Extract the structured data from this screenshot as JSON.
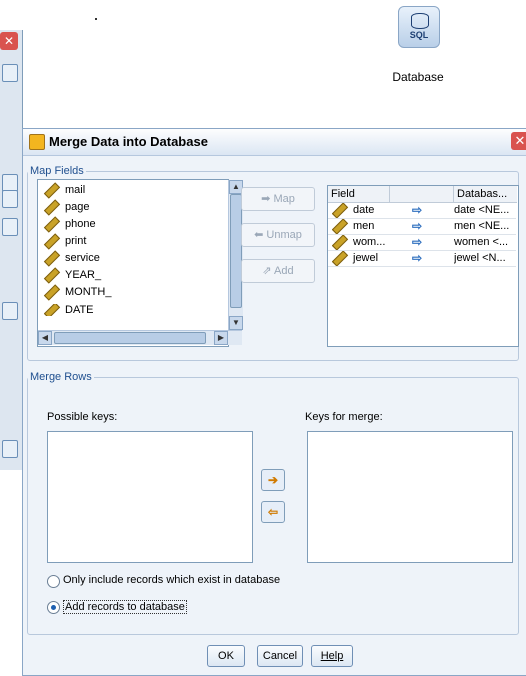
{
  "canvas": {
    "database_node": {
      "icon": "sql-database-icon",
      "badge": "SQL",
      "label": "Database"
    }
  },
  "dialog": {
    "title": "Merge Data into Database",
    "map_fields": {
      "legend": "Map Fields",
      "field_list": [
        "mail",
        "page",
        "phone",
        "print",
        "service",
        "YEAR_",
        "MONTH_",
        "DATE"
      ],
      "buttons": {
        "map": "Map",
        "unmap": "Unmap",
        "add": "Add"
      },
      "table": {
        "headers": [
          "Field",
          "",
          "Databas..."
        ],
        "rows": [
          {
            "field": "date",
            "db": "date <NE..."
          },
          {
            "field": "men",
            "db": "men <NE..."
          },
          {
            "field": "wom...",
            "db": "women <..."
          },
          {
            "field": "jewel",
            "db": "jewel <N..."
          }
        ]
      }
    },
    "merge_rows": {
      "legend": "Merge Rows",
      "possible_keys_label": "Possible keys:",
      "keys_for_merge_label": "Keys for merge:",
      "options": [
        {
          "label": "Only include records which exist in database",
          "selected": false
        },
        {
          "label": "Add records to database",
          "selected": true
        }
      ]
    },
    "footer": {
      "ok": "OK",
      "cancel": "Cancel",
      "help": "Help"
    }
  }
}
